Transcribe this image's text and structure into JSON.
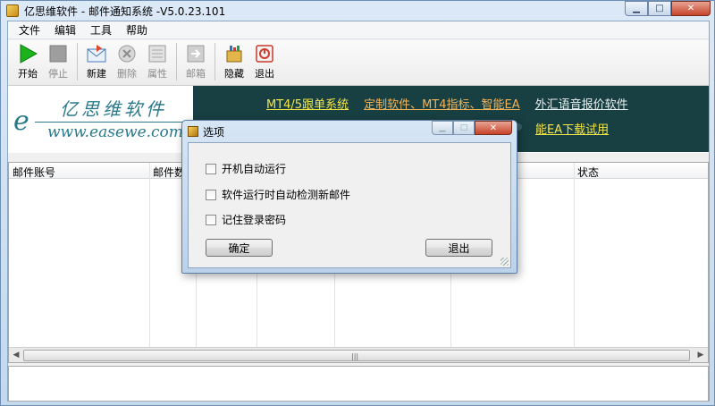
{
  "window": {
    "title": "亿思维软件 - 邮件通知系统 -V5.0.23.101",
    "buttons": {
      "minimize": "▁",
      "maximize": "□",
      "close": "✕"
    }
  },
  "menu": [
    "文件",
    "编辑",
    "工具",
    "帮助"
  ],
  "toolbar": {
    "start": "开始",
    "stop": "停止",
    "new": "新建",
    "delete": "删除",
    "properties": "属性",
    "mailbox": "邮箱",
    "hide": "隐藏",
    "exit": "退出"
  },
  "banner": {
    "logo_cn": "亿思维软件",
    "logo_en": "www.easewe.com",
    "logo_mark": "e",
    "links": [
      "MT4/5跟单系统",
      "定制软件、MT4指标、智能EA",
      "外汇语音报价软件"
    ],
    "link_bottom": "能EA下载试用"
  },
  "table": {
    "columns": [
      "邮件账号",
      "邮件数",
      "状态"
    ],
    "scroll_left": "◀",
    "scroll_right": "▶",
    "scroll_grip": "|||"
  },
  "dialog": {
    "title": "选项",
    "options": [
      "开机自动运行",
      "软件运行时自动检测新邮件",
      "记住登录密码"
    ],
    "ok": "确定",
    "exit": "退出",
    "buttons": {
      "minimize": "▁",
      "maximize": "□",
      "close": "✕"
    }
  },
  "colors": {
    "banner_bg": "#183f42",
    "link_yellow": "#f4e64a",
    "link_orange": "#f2b45a",
    "logo_teal": "#2a7a8a"
  }
}
